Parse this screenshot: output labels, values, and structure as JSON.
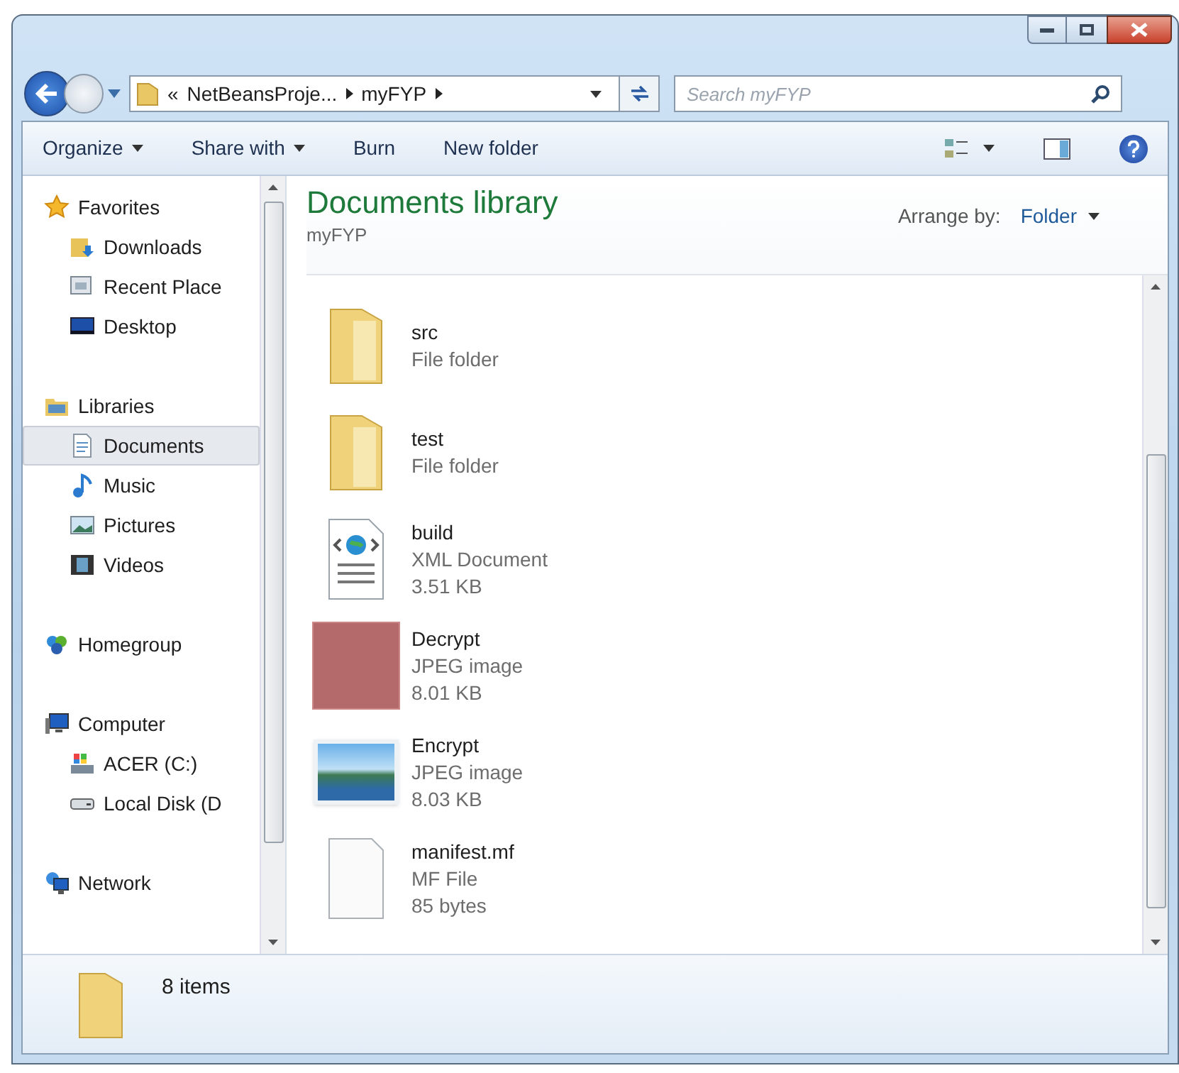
{
  "address": {
    "crumbs": [
      "«",
      "NetBeansProje...",
      "myFYP"
    ]
  },
  "search": {
    "placeholder": "Search myFYP"
  },
  "toolbar": {
    "items": [
      {
        "label": "Organize",
        "dropdown": true
      },
      {
        "label": "Share with",
        "dropdown": true
      },
      {
        "label": "Burn",
        "dropdown": false
      },
      {
        "label": "New folder",
        "dropdown": false
      }
    ]
  },
  "sidebar": {
    "groups": [
      {
        "label": "Favorites",
        "kind": "favorites",
        "selected": false,
        "children": [
          {
            "label": "Downloads",
            "kind": "downloads",
            "selected": false
          },
          {
            "label": "Recent Place",
            "kind": "recent",
            "selected": false
          },
          {
            "label": "Desktop",
            "kind": "desktop",
            "selected": false
          }
        ]
      },
      {
        "label": "Libraries",
        "kind": "libraries",
        "selected": false,
        "children": [
          {
            "label": "Documents",
            "kind": "documents",
            "selected": true
          },
          {
            "label": "Music",
            "kind": "music",
            "selected": false
          },
          {
            "label": "Pictures",
            "kind": "pictures",
            "selected": false
          },
          {
            "label": "Videos",
            "kind": "videos",
            "selected": false
          }
        ]
      },
      {
        "label": "Homegroup",
        "kind": "homegroup",
        "selected": false
      },
      {
        "label": "Computer",
        "kind": "computer",
        "selected": false,
        "children": [
          {
            "label": "ACER (C:)",
            "kind": "drive",
            "selected": false
          },
          {
            "label": "Local Disk (D",
            "kind": "disk",
            "selected": false
          }
        ]
      },
      {
        "label": "Network",
        "kind": "network",
        "selected": false
      }
    ]
  },
  "library": {
    "title": "Documents library",
    "subtitle": "myFYP",
    "arrange_label": "Arrange by:",
    "arrange_value": "Folder"
  },
  "files": [
    {
      "name": "src",
      "kind": "folder",
      "type": "File folder"
    },
    {
      "name": "test",
      "kind": "folder",
      "type": "File folder"
    },
    {
      "name": "build",
      "kind": "xml",
      "type": "XML Document",
      "size": "3.51 KB"
    },
    {
      "name": "Decrypt",
      "kind": "photo",
      "type": "JPEG image",
      "size": "8.01 KB"
    },
    {
      "name": "Encrypt",
      "kind": "landscape",
      "type": "JPEG image",
      "size": "8.03 KB"
    },
    {
      "name": "manifest.mf",
      "kind": "blank",
      "type": "MF File",
      "size": "85 bytes"
    }
  ],
  "status_bar": {
    "count": "8 items"
  }
}
